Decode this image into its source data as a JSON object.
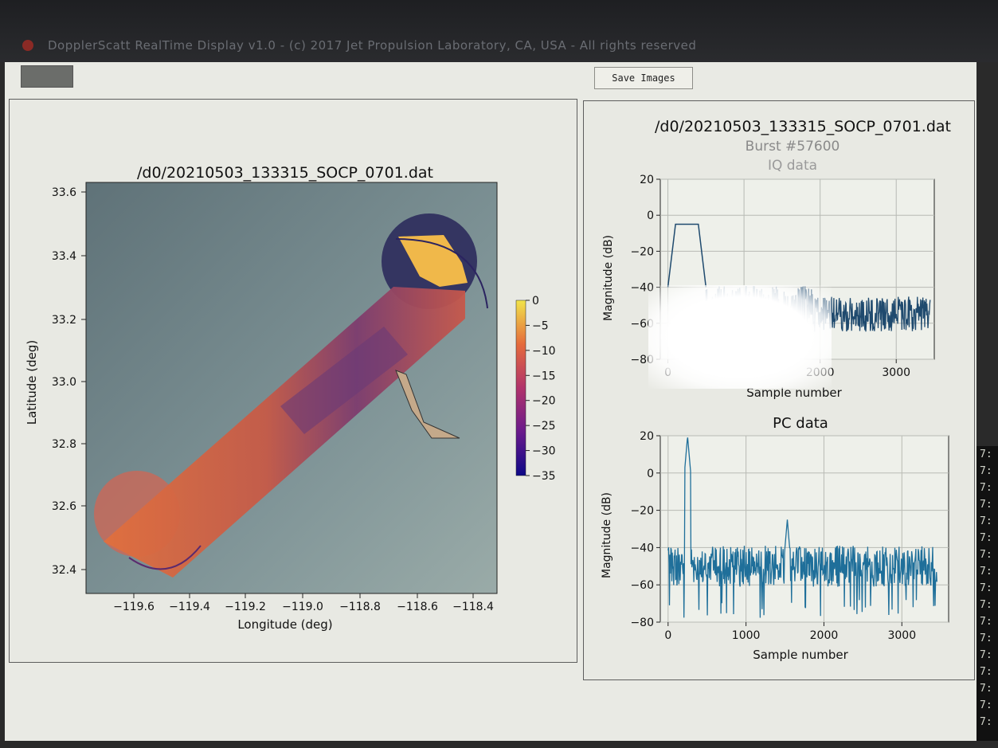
{
  "window": {
    "title": "DopplerScatt RealTime Display v1.0 - (c) 2017 Jet Propulsion Laboratory, CA, USA - All rights reserved"
  },
  "toolbar": {
    "save_label": "Save Images"
  },
  "map": {
    "title": "/d0/20210503_133315_SOCP_0701.dat",
    "xlabel": "Longitude (deg)",
    "ylabel": "Latitude (deg)",
    "xticks": [
      "−119.6",
      "−119.4",
      "−119.2",
      "−119.0",
      "−118.8",
      "−118.6",
      "−118.4"
    ],
    "yticks": [
      "33.6",
      "33.4",
      "33.2",
      "33.0",
      "32.8",
      "32.6",
      "32.4"
    ],
    "colorbar_ticks": [
      "0",
      "−5",
      "−10",
      "−15",
      "−20",
      "−25",
      "−30",
      "−35"
    ]
  },
  "right_header": {
    "file": "/d0/20210503_133315_SOCP_0701.dat",
    "burst": "Burst #57600"
  },
  "chart_data": [
    {
      "type": "line",
      "title": "IQ data",
      "xlabel": "Sample number",
      "ylabel": "Magnitude (dB)",
      "xlim": [
        -100,
        3500
      ],
      "ylim": [
        -80,
        20
      ],
      "xticks": [
        "0",
        "1000",
        "2000",
        "3000"
      ],
      "yticks": [
        "20",
        "0",
        "−20",
        "−40",
        "−60",
        "−80"
      ],
      "grid": true,
      "color": "#1f4a6e",
      "noise_floor": -50,
      "segments": [
        {
          "x": [
            0,
            100,
            300,
            400,
            500
          ],
          "y": [
            -40,
            -5,
            -5,
            -5,
            -40
          ]
        }
      ]
    },
    {
      "type": "line",
      "title": "PC data",
      "xlabel": "Sample number",
      "ylabel": "Magnitude (dB)",
      "xlim": [
        -100,
        3600
      ],
      "ylim": [
        -80,
        20
      ],
      "xticks": [
        "0",
        "1000",
        "2000",
        "3000"
      ],
      "yticks": [
        "20",
        "0",
        "−20",
        "−40",
        "−60",
        "−80"
      ],
      "grid": true,
      "color": "#1f6f9a",
      "noise_floor": -50,
      "peaks": [
        {
          "x": 250,
          "y": 20
        },
        {
          "x": 1530,
          "y": -25
        }
      ]
    }
  ],
  "terminal": {
    "lines": [
      "7:",
      "7:",
      "7:",
      "7:",
      "7:",
      "7:",
      "7:",
      "7:",
      "7:",
      "7:",
      "7:",
      "7:",
      "7:",
      "7:",
      "7:",
      "7:",
      "7:"
    ]
  }
}
